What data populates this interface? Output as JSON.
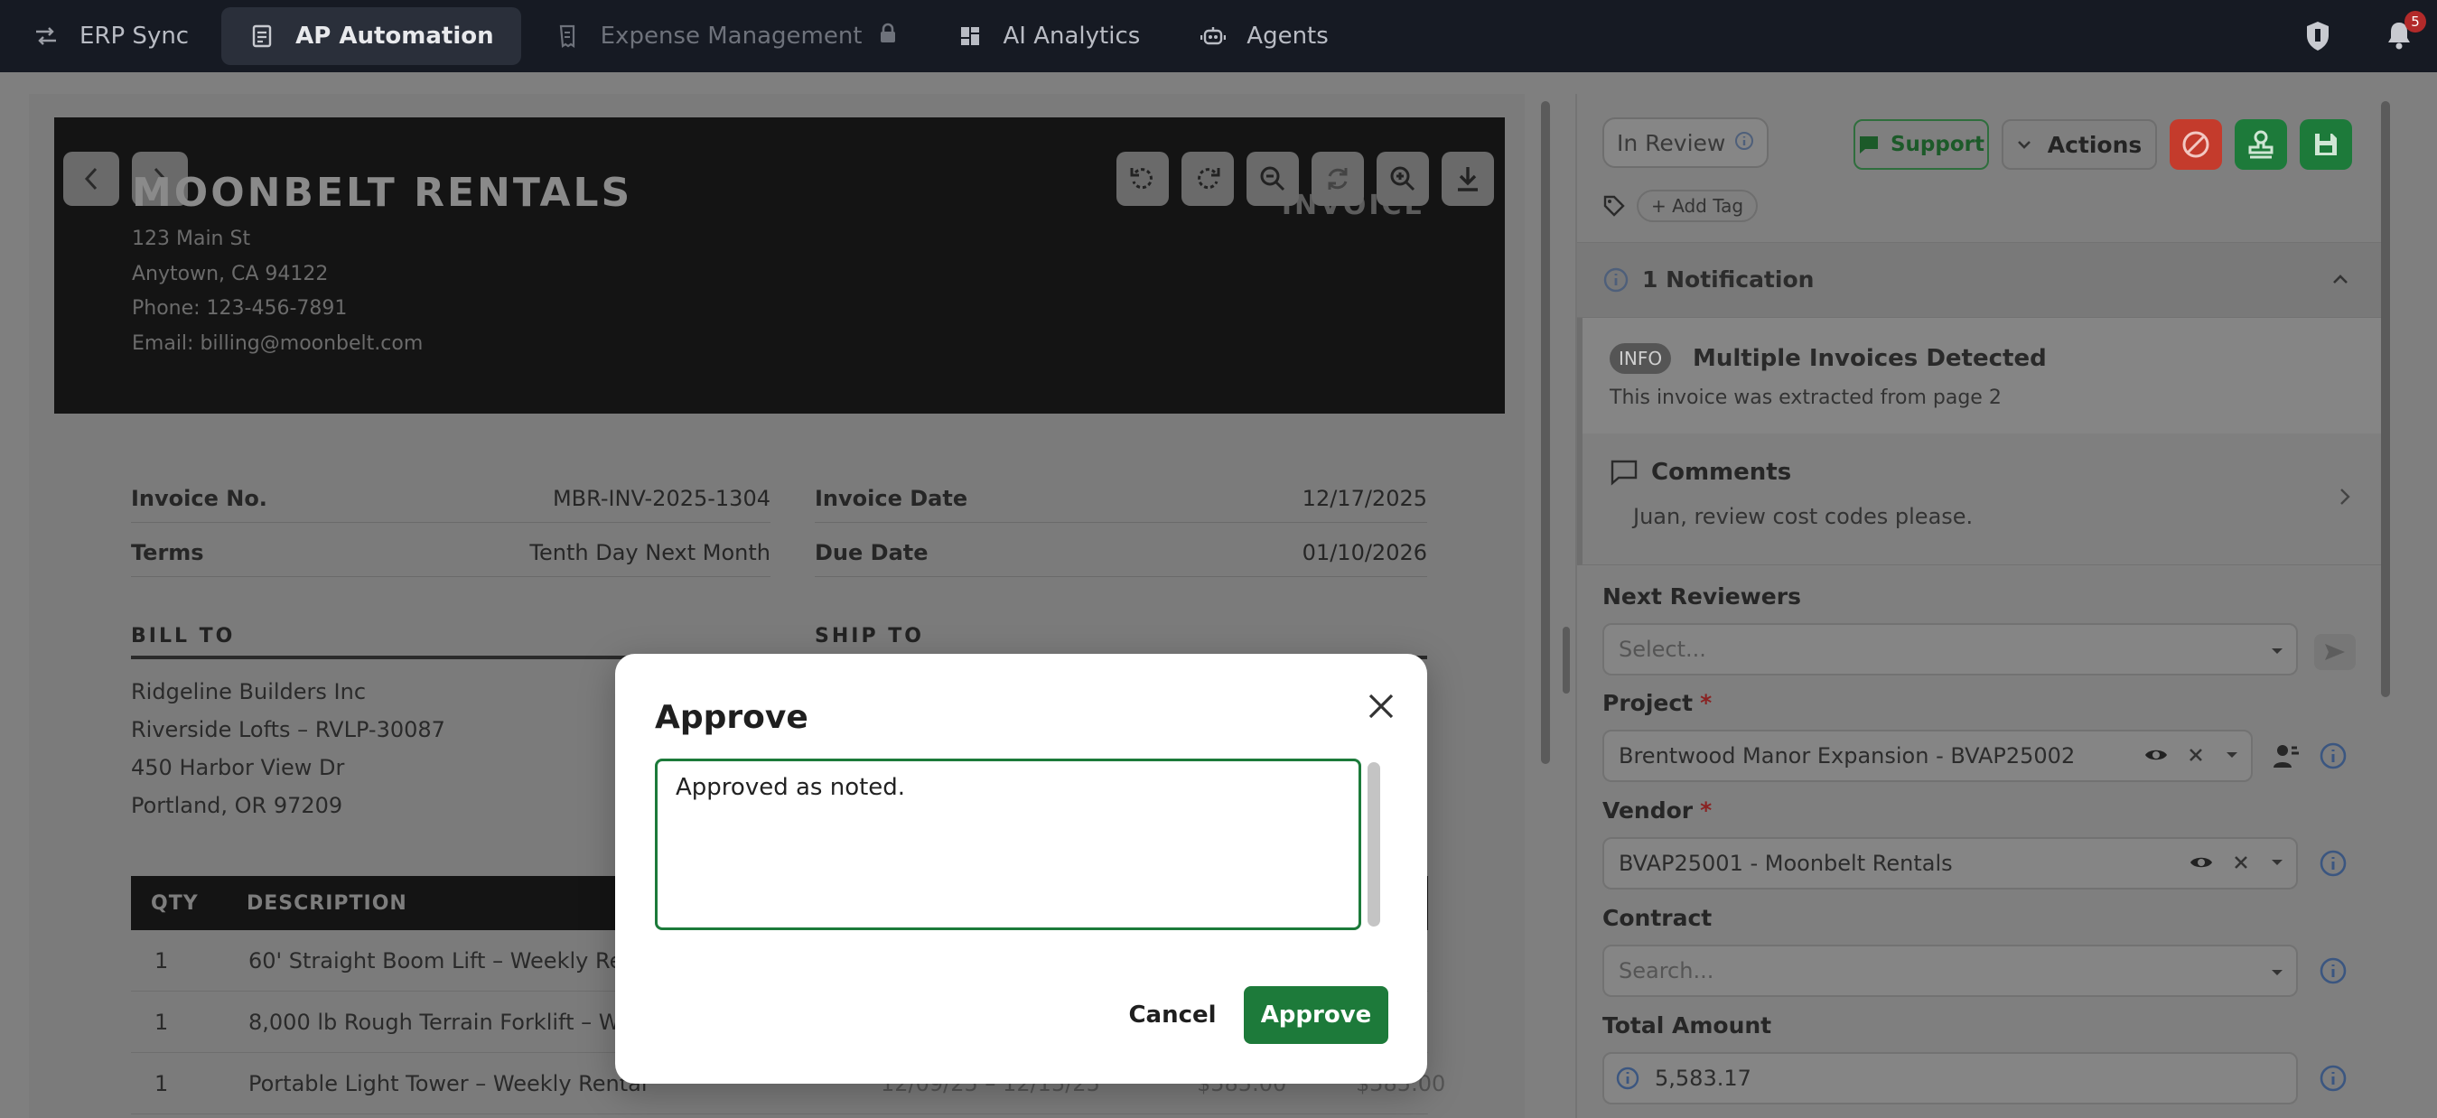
{
  "nav": {
    "tabs": [
      {
        "label": "ERP Sync",
        "icon": "swap-arrows-icon"
      },
      {
        "label": "AP Automation",
        "icon": "document-icon"
      },
      {
        "label": "Expense Management",
        "icon": "receipt-icon"
      },
      {
        "label": "AI Analytics",
        "icon": "dashboard-icon"
      },
      {
        "label": "Agents",
        "icon": "robot-icon"
      }
    ],
    "notification_count": "5"
  },
  "document": {
    "company": "MOONBELT RENTALS",
    "doc_type": "INVOICE",
    "address": [
      "123 Main St",
      "Anytown, CA 94122",
      "Phone: 123-456-7891",
      "Email: billing@moonbelt.com"
    ],
    "invoice_no_label": "Invoice No.",
    "invoice_no": "MBR-INV-2025-1304",
    "invoice_date_label": "Invoice Date",
    "invoice_date": "12/17/2025",
    "terms_label": "Terms",
    "terms": "Tenth Day Next Month",
    "due_date_label": "Due Date",
    "due_date": "01/10/2026",
    "bill_to_label": "BILL TO",
    "ship_to_label": "SHIP TO",
    "bill_to": [
      "Ridgeline Builders Inc",
      "Riverside Lofts – RVLP-30087",
      "450 Harbor View Dr",
      "Portland, OR 97209"
    ],
    "table_headers": [
      "QTY",
      "DESCRIPTION"
    ],
    "rows": [
      {
        "qty": "1",
        "desc": "60' Straight Boom Lift – Weekly Rental"
      },
      {
        "qty": "1",
        "desc": "8,000 lb Rough Terrain Forklift – Weekly Rental"
      },
      {
        "qty": "1",
        "desc": "Portable Light Tower – Weekly Rental",
        "period": "12/09/25 – 12/15/25",
        "rate": "$585.00",
        "amount": "$585.00"
      }
    ]
  },
  "panel": {
    "status": "In Review",
    "support_label": "Support",
    "actions_label": "Actions",
    "add_tag_label": "+ Add Tag",
    "notification_header": "1 Notification",
    "notification_badge": "INFO",
    "notification_title": "Multiple Invoices Detected",
    "notification_text": "This invoice was extracted from page 2",
    "comments_title": "Comments",
    "comment_text": "Juan, review cost codes please.",
    "next_reviewers_label": "Next Reviewers",
    "next_reviewers_placeholder": "Select...",
    "project_label": "Project",
    "project_value": "Brentwood Manor Expansion - BVAP25002",
    "vendor_label": "Vendor",
    "vendor_value": "BVAP25001 - Moonbelt Rentals",
    "contract_label": "Contract",
    "contract_placeholder": "Search...",
    "total_label": "Total Amount",
    "total_value": "5,583.17"
  },
  "modal": {
    "title": "Approve",
    "text": "Approved as noted. ",
    "cancel_label": "Cancel",
    "approve_label": "Approve"
  },
  "colors": {
    "accent_green": "#1d7a3a",
    "danger_red": "#c43b2c",
    "nav_bg": "#161a23"
  }
}
